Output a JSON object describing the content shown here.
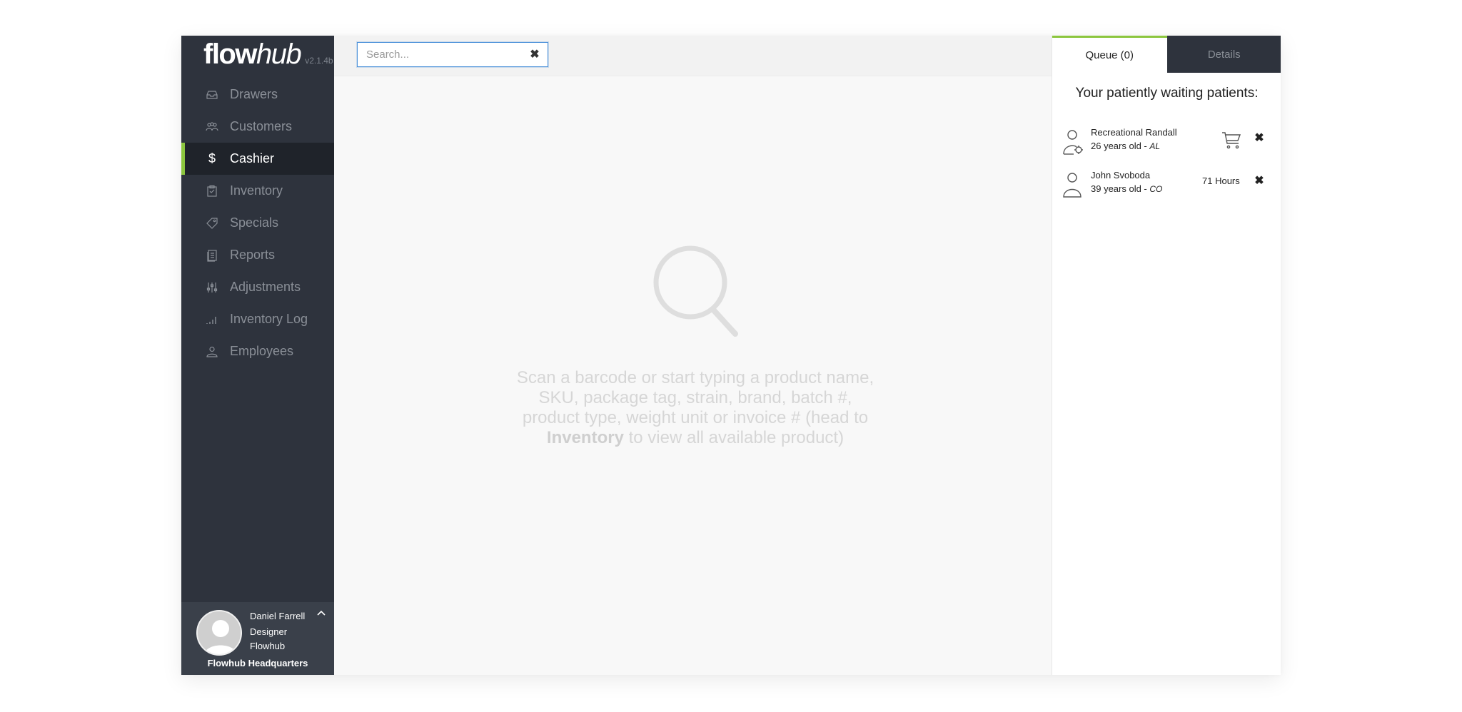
{
  "app": {
    "logo_bold": "flow",
    "logo_italic": "hub",
    "version": "v2.1.4b"
  },
  "sidebar": {
    "items": [
      {
        "label": "Drawers",
        "icon": "drawer-icon"
      },
      {
        "label": "Customers",
        "icon": "customers-icon"
      },
      {
        "label": "Cashier",
        "icon": "dollar-icon",
        "active": true
      },
      {
        "label": "Inventory",
        "icon": "clipboard-icon"
      },
      {
        "label": "Specials",
        "icon": "tag-icon"
      },
      {
        "label": "Reports",
        "icon": "report-icon"
      },
      {
        "label": "Adjustments",
        "icon": "sliders-icon"
      },
      {
        "label": "Inventory Log",
        "icon": "bar-chart-icon"
      },
      {
        "label": "Employees",
        "icon": "employee-icon"
      }
    ],
    "user": {
      "name": "Daniel Farrell",
      "role": "Designer",
      "company": "Flowhub",
      "location": "Flowhub Headquarters"
    }
  },
  "search": {
    "placeholder": "Search...",
    "value": ""
  },
  "empty_state": {
    "text_before": "Scan a barcode or start typing a product name, SKU, package tag, strain, brand, batch #, product type, weight unit or invoice # (head to ",
    "text_bold": "Inventory",
    "text_after": " to view all available product)"
  },
  "right_panel": {
    "tabs": [
      {
        "label": "Queue (0)",
        "active": true
      },
      {
        "label": "Details",
        "active": false
      }
    ],
    "heading": "Your patiently waiting patients:",
    "patients": [
      {
        "name": "Recreational Randall",
        "age": "26 years old - ",
        "state": "AL",
        "status": "cart"
      },
      {
        "name": "John Svoboda",
        "age": "39 years old - ",
        "state": "CO",
        "time": "71 Hours"
      }
    ]
  },
  "colors": {
    "sidebar_bg": "#2e333d",
    "accent": "#8cc63e",
    "active_item_bg": "#1f232a"
  }
}
